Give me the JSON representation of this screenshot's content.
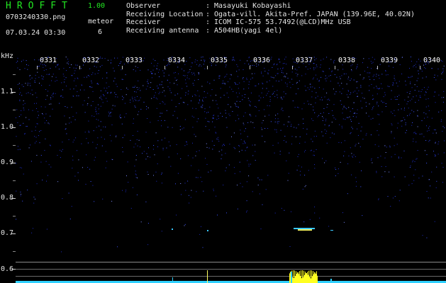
{
  "app": {
    "title": "HROFFT",
    "version": "1.00"
  },
  "file": {
    "name": "0703240330.png",
    "datetime": "07.03.24 03:30"
  },
  "meteor": {
    "label": "meteor",
    "count": "6"
  },
  "info": [
    {
      "key": "Observer",
      "value": "Masayuki Kobayashi"
    },
    {
      "key": "Receiving Location",
      "value": "Ogata-vill. Akita-Pref. JAPAN (139.96E, 40.02N)"
    },
    {
      "key": "Receiver",
      "value": "ICOM IC-575 53.7492(@LCD)MHz USB"
    },
    {
      "key": "Receiving antenna",
      "value": "A504HB(yagi 4el)"
    }
  ],
  "axis": {
    "unit": "kHz",
    "y_ticks": [
      "1.1",
      "1.0",
      "0.9",
      "0.8",
      "0.7",
      "0.6"
    ],
    "x_ticks": [
      "0331",
      "0332",
      "0333",
      "0334",
      "0335",
      "0336",
      "0337",
      "0338",
      "0339",
      "0340"
    ]
  },
  "colors": {
    "title": "#22e822",
    "noise": "#2a3cff",
    "signal": "#ffff20",
    "text": "#e6e6e6"
  }
}
